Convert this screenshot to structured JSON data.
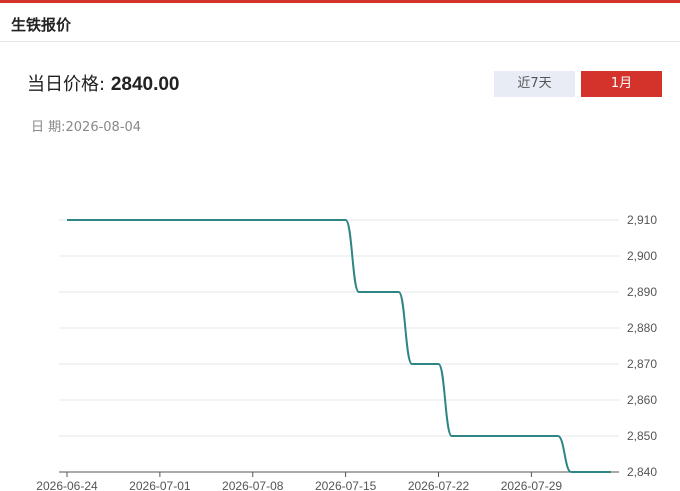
{
  "header": {
    "title": "生铁报价"
  },
  "price": {
    "label": "当日价格:",
    "value": "2840.00"
  },
  "date": {
    "label": "日 期:",
    "value": "2026-08-04"
  },
  "range_buttons": {
    "week": "近7天",
    "month": "1月"
  },
  "colors": {
    "accent": "#d3332a",
    "line": "#2e8583",
    "grid": "#e3e7ef",
    "inactive_btn": "#e8edf5"
  },
  "chart_data": {
    "type": "line",
    "title": "",
    "xlabel": "",
    "ylabel": "",
    "x_ticks": [
      "2026-06-24",
      "2026-07-01",
      "2026-07-08",
      "2026-07-15",
      "2026-07-22",
      "2026-07-29"
    ],
    "y_ticks": [
      "2,840",
      "2,850",
      "2,860",
      "2,870",
      "2,880",
      "2,890",
      "2,900",
      "2,910"
    ],
    "ylim": [
      2840,
      2910
    ],
    "xlim": [
      "2026-06-24",
      "2026-08-04"
    ],
    "grid": true,
    "y_axis_side": "right",
    "series": [
      {
        "x": [
          "2026-06-24",
          "2026-07-15",
          "2026-07-16",
          "2026-07-19",
          "2026-07-20",
          "2026-07-22",
          "2026-07-23",
          "2026-07-31",
          "2026-08-01",
          "2026-08-04"
        ],
        "values": [
          2910,
          2910,
          2890,
          2890,
          2870,
          2870,
          2850,
          2850,
          2840,
          2840
        ]
      }
    ]
  }
}
